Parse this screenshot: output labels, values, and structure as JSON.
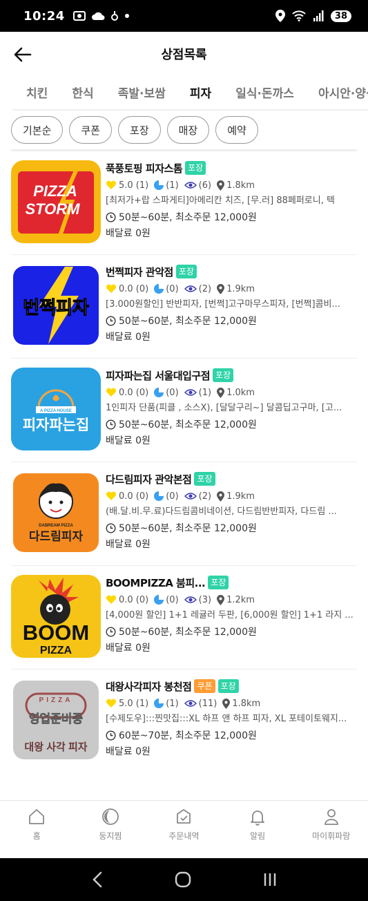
{
  "status": {
    "time": "10:24",
    "battery": "38"
  },
  "appbar": {
    "title": "상점목록"
  },
  "tabs": [
    "치킨",
    "한식",
    "족발·보쌈",
    "피자",
    "일식·돈까스",
    "아시안·양식"
  ],
  "active_tab": "피자",
  "filters": [
    "기본순",
    "쿠폰",
    "포장",
    "매장",
    "예약"
  ],
  "stores": [
    {
      "name": "푹풍토핑 피자스톰",
      "badges": [
        "포장"
      ],
      "rating": "5.0 (1)",
      "likes": "(1)",
      "views": "(6)",
      "distance": "1.8km",
      "menu": "[최저가+랍 스파게티]아메리칸 치즈, [무.러] 88페퍼로니, 텍",
      "time": "50분~60분, 최소주문 12,000원",
      "fee": "배달료 0원",
      "logo": {
        "line1": "PIZZA",
        "line2": "STORM",
        "bg": "#f7b90f",
        "panel": "#e0272f"
      }
    },
    {
      "name": "번쩍피자 관악점",
      "badges": [
        "포장"
      ],
      "rating": "0.0 (0)",
      "likes": "(0)",
      "views": "(2)",
      "distance": "1.9km",
      "menu": "[3.000원할인] 반반피자, [번쩍]고구마무스피자, [번쩍]콤비...",
      "time": "50분~60분, 최소주문 12,000원",
      "fee": "배달료 0원",
      "logo": {
        "line1": "번쩍피자",
        "bg": "#1a22e6"
      }
    },
    {
      "name": "피자파는집 서울대입구점",
      "badges": [
        "포장"
      ],
      "rating": "0.0 (0)",
      "likes": "(0)",
      "views": "(1)",
      "distance": "1.0km",
      "menu": "1인피자 단품(피클 , 소스X), [달달구리~] 달콤딥고구마, [고...",
      "time": "50분~60분, 최소주문 12,000원",
      "fee": "배달료 0원",
      "logo": {
        "line1": "A PIZZA HOUSE",
        "line2": "피자파는집",
        "bg": "#2aa2e1"
      }
    },
    {
      "name": "다드림피자 관악본점",
      "badges": [
        "포장"
      ],
      "rating": "0.0 (0)",
      "likes": "(0)",
      "views": "(2)",
      "distance": "1.9km",
      "menu": "(배.달.비.무.료)다드림콤비네이션, 다드림반반피자, 다드림 ...",
      "time": "50분~60분, 최소주문 12,000원",
      "fee": "배달료 0원",
      "logo": {
        "line1": "DABREAM PIZZA",
        "line2": "다드림피자",
        "bg": "#f48a1f"
      }
    },
    {
      "name": "BOOMPIZZA 붐피...",
      "badges": [
        "포장"
      ],
      "rating": "0.0 (0)",
      "likes": "(0)",
      "views": "(3)",
      "distance": "1.2km",
      "menu": "[4,000원 할인] 1+1 레귤러 두판, [6,000원 할인] 1+1 라지 ...",
      "time": "50분~60분, 최소주문 12,000원",
      "fee": "배달료 0원",
      "logo": {
        "line1": "BOOM",
        "line2": "PIZZA",
        "bg": "#f5c416"
      }
    },
    {
      "name": "대왕사각피자 봉천점",
      "badges": [
        "쿠폰",
        "포장"
      ],
      "rating": "5.0 (1)",
      "likes": "(1)",
      "views": "(11)",
      "distance": "1.8km",
      "menu": "[수제도우]:::찐맛집:::XL 하프 앤 하프 피자, XL 포테이토웨지...",
      "time": "60분~70분, 최소주문 12,000원",
      "fee": "배달료 0원",
      "logo": {
        "line1": "PIZZA",
        "line2": "대왕 사각 피자",
        "overlay": "영업준비중",
        "bg": "#c9c9c9"
      }
    }
  ],
  "bottom_nav": [
    "홈",
    "둥지찜",
    "주문내역",
    "알림",
    "마이휘파람"
  ],
  "colors": {
    "pack_badge": "#2fd3a7",
    "coupon_badge": "#ff9c35",
    "heart": "#ffd800",
    "like": "#3aa0f0"
  }
}
